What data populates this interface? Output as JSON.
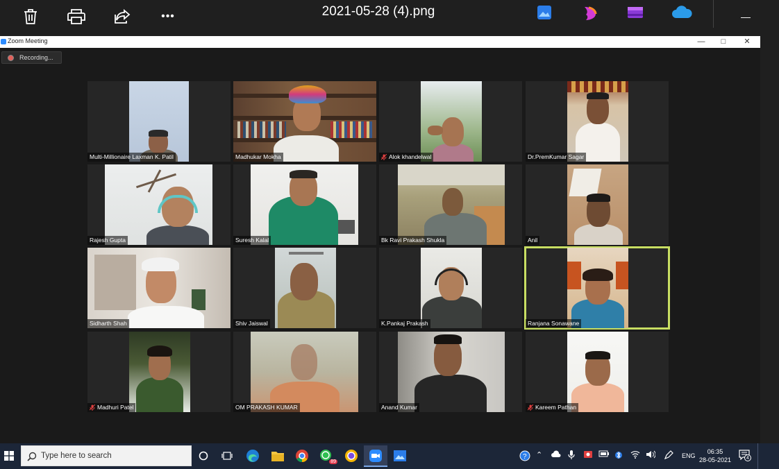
{
  "viewer": {
    "title": "2021-05-28 (4).png",
    "buttons": [
      "delete",
      "print",
      "share",
      "more"
    ],
    "more_label": "•••",
    "minimize_label": "—"
  },
  "zoom": {
    "window_title": "Zoom Meeting",
    "controls": {
      "minimize": "—",
      "restore": "□",
      "close": "✕"
    },
    "recording_label": "Recording..."
  },
  "participants": [
    {
      "name": "Multi-Millionaire Laxman K. Patil",
      "muted": false,
      "active": false
    },
    {
      "name": "Madhukar Mokha",
      "muted": false,
      "active": false
    },
    {
      "name": "Alok khandelwal",
      "muted": true,
      "active": false
    },
    {
      "name": "Dr.PremKumar Sagar",
      "muted": false,
      "active": false
    },
    {
      "name": "Rajesh Gupta",
      "muted": false,
      "active": false
    },
    {
      "name": "Suresh Kalal",
      "muted": false,
      "active": false
    },
    {
      "name": "Bk Ravi Prakash Shukla",
      "muted": false,
      "active": false
    },
    {
      "name": "Anil",
      "muted": false,
      "active": false
    },
    {
      "name": "Sidharth Shah",
      "muted": false,
      "active": false
    },
    {
      "name": "Shiv Jaiswal",
      "muted": false,
      "active": false
    },
    {
      "name": "K.Pankaj Prakash",
      "muted": false,
      "active": false
    },
    {
      "name": "Ranjana Sonawane",
      "muted": false,
      "active": true
    },
    {
      "name": "Madhuri Patel",
      "muted": true,
      "active": false
    },
    {
      "name": "OM PRAKASH KUMAR",
      "muted": false,
      "active": false
    },
    {
      "name": "Anand Kumar",
      "muted": false,
      "active": false
    },
    {
      "name": "Kareem Pathan",
      "muted": true,
      "active": false
    }
  ],
  "taskbar": {
    "search_placeholder": "Type here to search",
    "whatsapp_badge": "89",
    "language": "ENG",
    "time": "06:35",
    "date": "28-05-2021",
    "notification_count": "4"
  },
  "colors": {
    "active_speaker_border": "#c8de62",
    "taskbar_bg": "#1c2638",
    "zoom_blue": "#2d8cff",
    "recording_red": "#e0605a"
  }
}
